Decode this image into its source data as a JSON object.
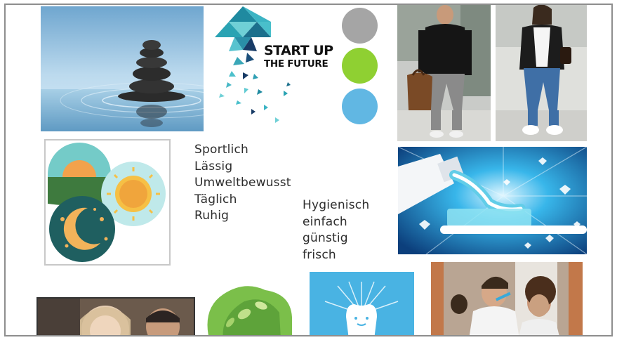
{
  "logo": {
    "line1": "START UP",
    "line2": "THE FUTURE"
  },
  "color_swatches": [
    "#a5a5a5",
    "#8fd032",
    "#61b7e3"
  ],
  "keywords_left": [
    "Sportlich",
    "Lässig",
    "Umweltbewusst",
    "Täglich",
    "Ruhig"
  ],
  "keywords_right": [
    "Hygienisch",
    "einfach",
    "günstig",
    "frisch"
  ]
}
